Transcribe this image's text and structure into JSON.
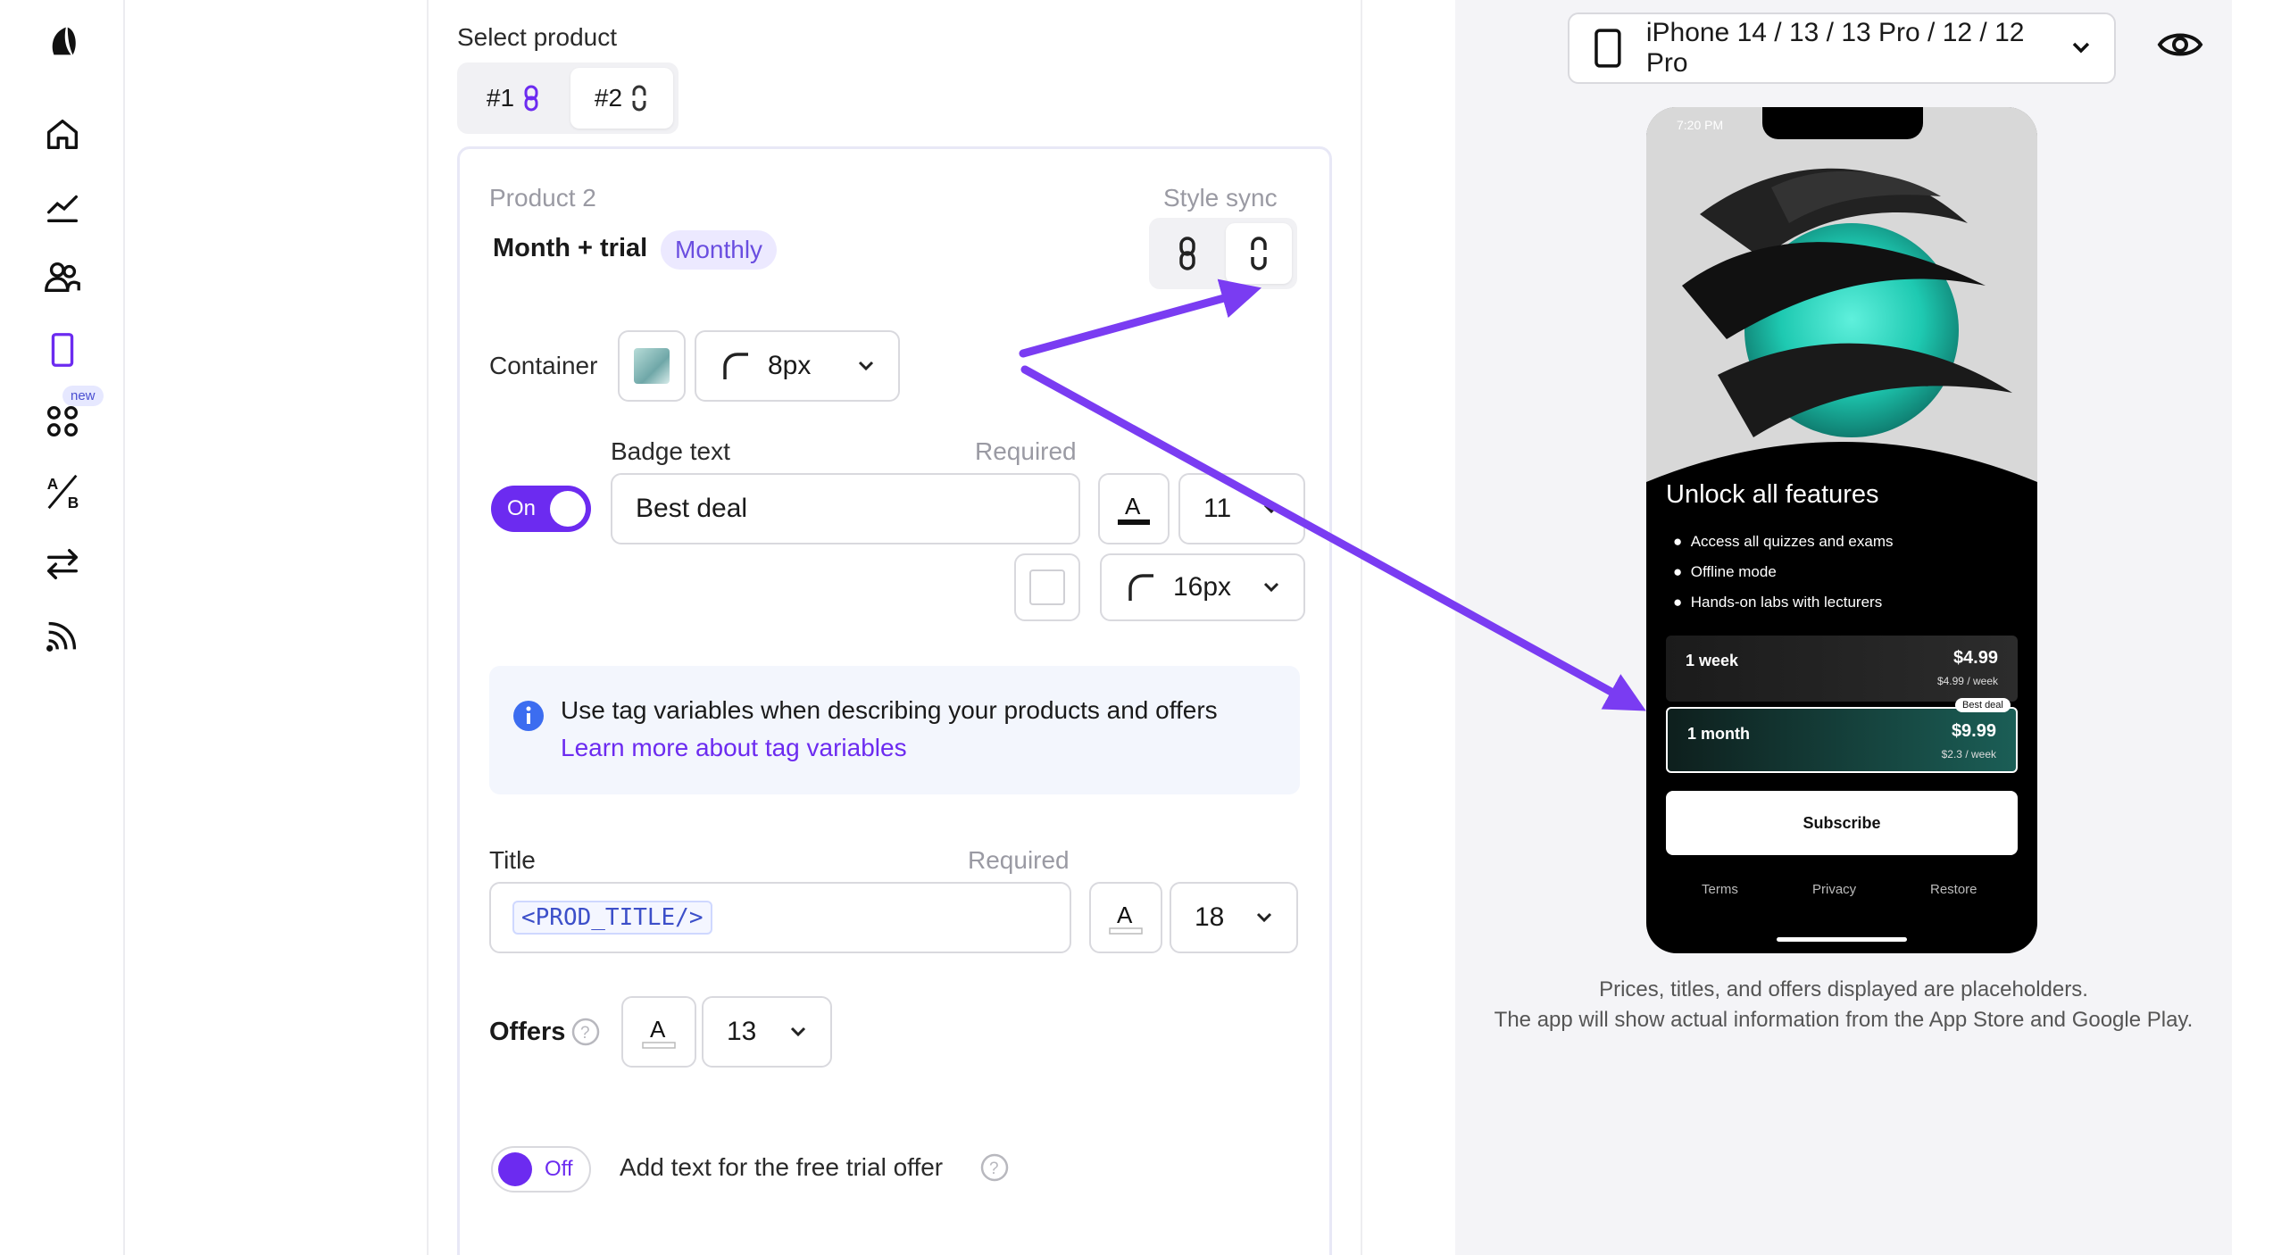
{
  "nav": {
    "badge_new": "new"
  },
  "editor": {
    "select_product_label": "Select product",
    "product_tabs": [
      {
        "label": "#1"
      },
      {
        "label": "#2"
      }
    ],
    "product_title": "Product 2",
    "product_name": "Month + trial",
    "product_period": "Monthly",
    "style_sync_label": "Style sync",
    "container_label": "Container",
    "container_radius": "8px",
    "badge_text_label": "Badge text",
    "badge_required": "Required",
    "badge_toggle": "On",
    "badge_value": "Best deal",
    "badge_font_size": "11",
    "badge_radius": "16px",
    "info_text": "Use tag variables when describing your products and offers",
    "info_link": "Learn more about tag variables",
    "title_label": "Title",
    "title_required": "Required",
    "title_value": "<PROD_TITLE/>",
    "title_font_size": "18",
    "offers_label": "Offers",
    "offers_font_size": "13",
    "trial_toggle": "Off",
    "trial_text": "Add text for the free trial offer",
    "text_color_letter": "A"
  },
  "preview": {
    "device": "iPhone 14 / 13 / 13 Pro / 12 / 12 Pro",
    "phone_time": "7:20 PM",
    "headline": "Unlock all features",
    "bullets": [
      "Access all quizzes and exams",
      "Offline mode",
      "Hands-on labs with lecturers"
    ],
    "plans": [
      {
        "name": "1 week",
        "price": "$4.99",
        "per_week": "$4.99 / week"
      },
      {
        "name": "1 month",
        "price": "$9.99",
        "per_week": "$2.3 / week",
        "badge": "Best deal"
      }
    ],
    "subscribe": "Subscribe",
    "footer_links": [
      "Terms",
      "Privacy",
      "Restore"
    ],
    "note_line1": "Prices, titles, and offers displayed are placeholders.",
    "note_line2": "The app will show actual information from the App Store and Google Play."
  },
  "colors": {
    "accent": "#6c2bf0",
    "arrow": "#7a3cf2",
    "teal": "#2fd7c0"
  }
}
